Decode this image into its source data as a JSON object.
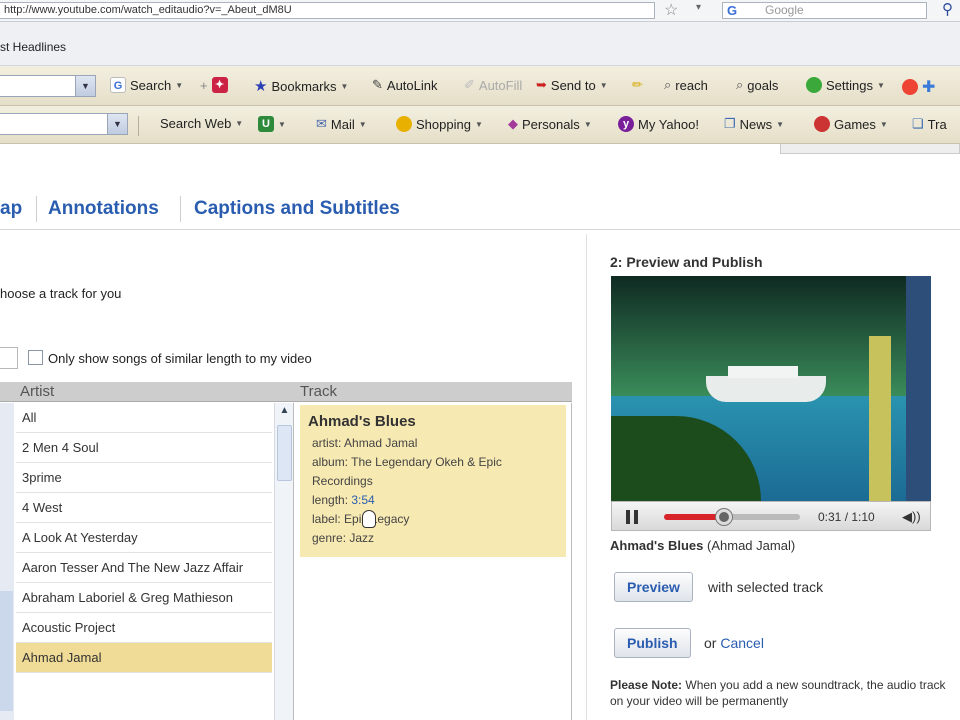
{
  "browser": {
    "url": "http://www.youtube.com/watch_editaudio?v=_Abeut_dM8U",
    "search_logo": "G",
    "search_placeholder": "Google",
    "headlines": "st Headlines"
  },
  "toolbar1": {
    "search": "Search",
    "bookmarks": "Bookmarks",
    "autolink": "AutoLink",
    "autofill": "AutoFill",
    "send_to": "Send to",
    "reach": "reach",
    "goals": "goals",
    "settings": "Settings"
  },
  "toolbar2": {
    "search_web": "Search Web",
    "mail": "Mail",
    "shopping": "Shopping",
    "personals": "Personals",
    "my_yahoo": "My Yahoo!",
    "news": "News",
    "games": "Games",
    "travel": "Tra"
  },
  "tabs": {
    "audioswap": "ap",
    "annotations": "Annotations",
    "captions": "Captions and Subtitles"
  },
  "chooser": {
    "instructions": "hoose a track for you",
    "checkbox_label": "Only show songs of similar length to my video",
    "artist_header": "Artist",
    "track_header": "Track",
    "artists": [
      "All",
      "2 Men 4 Soul",
      "3prime",
      "4 West",
      "A Look At Yesterday",
      "Aaron Tesser And The New Jazz Affair",
      "Abraham Laboriel & Greg Mathieson",
      "Acoustic Project",
      "Ahmad Jamal"
    ],
    "selected_artist": "Ahmad Jamal"
  },
  "track": {
    "title": "Ahmad's Blues",
    "artist": "artist: Ahmad Jamal",
    "album": "album: The Legendary Okeh & Epic Recordings",
    "length_label": "length: ",
    "length_value": "3:54",
    "label": "label: Epic Legacy",
    "genre": "genre: Jazz"
  },
  "preview": {
    "heading": "2: Preview and Publish",
    "time": "0:31 / 1:10",
    "progress_fraction": 0.44,
    "song": "Ahmad's Blues",
    "song_artist": " (Ahmad Jamal)",
    "preview_button": "Preview",
    "preview_suffix": "with selected track",
    "publish_button": "Publish",
    "or": "or ",
    "cancel": "Cancel",
    "note_label": "Please Note:",
    "note_text": " When you add a new soundtrack, the audio track on your video will be permanently"
  }
}
